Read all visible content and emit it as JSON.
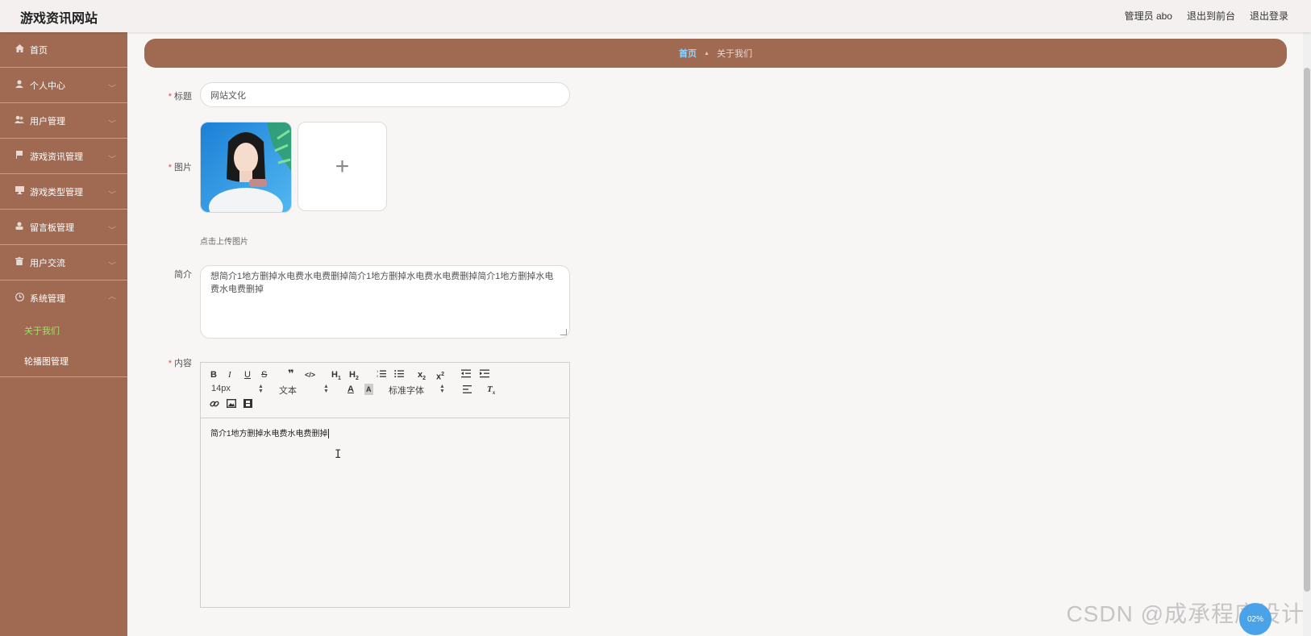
{
  "header": {
    "site_title": "游戏资讯网站",
    "admin": "管理员 abo",
    "to_front": "退出到前台",
    "logout": "退出登录"
  },
  "sidebar": {
    "items": [
      {
        "label": "首页",
        "icon": "home-icon",
        "expandable": false
      },
      {
        "label": "个人中心",
        "icon": "user-icon",
        "expandable": true
      },
      {
        "label": "用户管理",
        "icon": "users-icon",
        "expandable": true
      },
      {
        "label": "游戏资讯管理",
        "icon": "flag-icon",
        "expandable": true
      },
      {
        "label": "游戏类型管理",
        "icon": "monitor-icon",
        "expandable": true
      },
      {
        "label": "留言板管理",
        "icon": "person-icon",
        "expandable": true
      },
      {
        "label": "用户交流",
        "icon": "trash-icon",
        "expandable": true
      },
      {
        "label": "系统管理",
        "icon": "clock-icon",
        "expandable": true,
        "expanded": true
      }
    ],
    "sub_items": [
      {
        "label": "关于我们",
        "active": true
      },
      {
        "label": "轮播图管理",
        "active": false
      }
    ],
    "active_color": "#9be564",
    "bg_color": "#a06a52"
  },
  "breadcrumb": {
    "home": "首页",
    "current": "关于我们"
  },
  "form": {
    "title_label": "标题",
    "title_value": "网站文化",
    "image_label": "图片",
    "upload_tip": "点击上传图片",
    "intro_label": "简介",
    "intro_value": "想简介1地方删掉水电费水电费删掉简介1地方删掉水电费水电费删掉简介1地方删掉水电费水电费删掉",
    "content_label": "内容",
    "content_value": "简介1地方删掉水电费水电费删掉"
  },
  "editor": {
    "font_size": "14px",
    "heading": "文本",
    "font_family": "标准字体"
  },
  "watermark": "CSDN @成承程序设计",
  "float_button": "02%"
}
